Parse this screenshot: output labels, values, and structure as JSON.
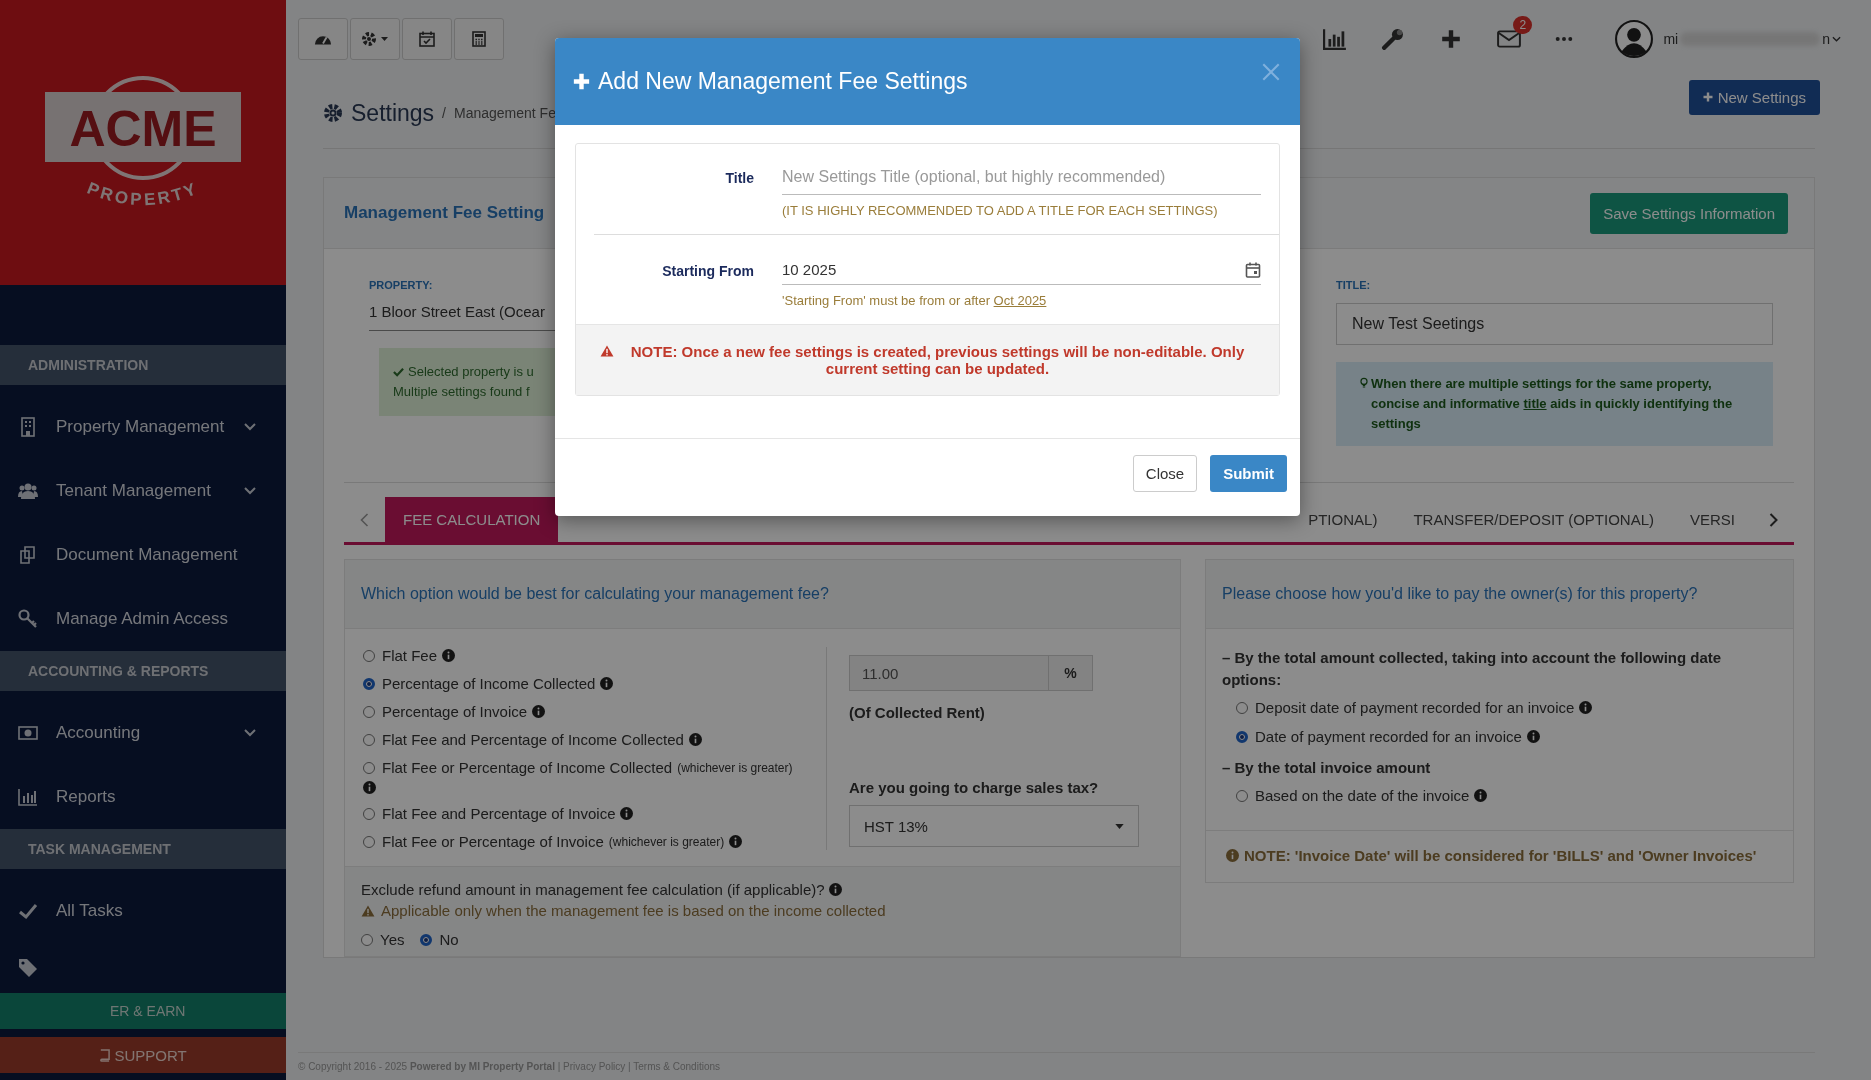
{
  "topbar": {
    "mail_badge": "2",
    "user_name_start": "mi",
    "user_name_end": "n"
  },
  "sidebar": {
    "logo": {
      "name": "ACME",
      "sub": "PROPERTY"
    },
    "sections": [
      {
        "heading": "ADMINISTRATION",
        "items": [
          {
            "label": "Property Management",
            "expandable": true
          },
          {
            "label": "Tenant Management",
            "expandable": true
          },
          {
            "label": "Document Management",
            "expandable": false
          },
          {
            "label": "Manage Admin Access",
            "expandable": false
          }
        ]
      },
      {
        "heading": "ACCOUNTING & REPORTS",
        "items": [
          {
            "label": "Accounting",
            "expandable": true
          },
          {
            "label": "Reports",
            "expandable": false
          }
        ]
      },
      {
        "heading": "TASK MANAGEMENT",
        "items": [
          {
            "label": "All Tasks",
            "expandable": false
          }
        ]
      }
    ],
    "refer_button": "ER & EARN",
    "support_button": "SUPPORT"
  },
  "breadcrumb": {
    "title": "Settings",
    "separator": "/",
    "current": "Management Fe"
  },
  "new_settings_button": "New Settings",
  "card": {
    "title": "Management Fee Setting",
    "save_button": "Save Settings Information",
    "property": {
      "label": "PROPERTY:",
      "value": "1 Bloor Street East (Ocear"
    },
    "alert_lines": [
      "Selected property is u",
      "Multiple settings found f"
    ],
    "title_field": {
      "label": "TITLE:",
      "value": "New Test Seetings"
    },
    "tip": {
      "before": "When there are multiple settings for the same property, concise and informative ",
      "link": "title",
      "after": " aids in quickly identifying the settings"
    }
  },
  "tabs": [
    {
      "label": "FEE CALCULATION",
      "selected": true
    },
    {
      "label": "PTIONAL)",
      "selected": false
    },
    {
      "label": "TRANSFER/DEPOSIT (OPTIONAL)",
      "selected": false
    },
    {
      "label": "VERSI",
      "selected": false
    }
  ],
  "fee_panel": {
    "question": "Which option would be best for calculating your management fee?",
    "options": [
      {
        "label": "Flat Fee",
        "selected": false
      },
      {
        "label": "Percentage of Income Collected",
        "selected": true
      },
      {
        "label": "Percentage of Invoice",
        "selected": false
      },
      {
        "label": "Flat Fee and Percentage of Income Collected",
        "selected": false
      },
      {
        "label": "Flat Fee or Percentage of Income Collected",
        "note": "(whichever is greater)",
        "selected": false
      },
      {
        "label": "Flat Fee and Percentage of Invoice",
        "selected": false
      },
      {
        "label": "Flat Fee or Percentage of Invoice",
        "note": "(whichever is greater)",
        "selected": false
      }
    ],
    "rate": {
      "value": "11.00",
      "unit": "%",
      "caption": "(Of Collected Rent)"
    },
    "tax": {
      "question": "Are you going to charge sales tax?",
      "value": "HST 13%"
    },
    "refund": {
      "question": "Exclude refund amount in management fee calculation (if applicable)?",
      "warning": "Applicable only when the management fee is based on the income collected",
      "options": [
        {
          "label": "Yes",
          "selected": false
        },
        {
          "label": "No",
          "selected": true
        }
      ]
    }
  },
  "owner_panel": {
    "question": "Please choose how you'd like to pay the owner(s) for this property?",
    "groups": [
      {
        "heading": "– By the total amount collected, taking into account the following date options:",
        "options": [
          {
            "label": "Deposit date of payment recorded for an invoice",
            "selected": false
          },
          {
            "label": "Date of payment recorded for an invoice",
            "selected": true
          }
        ]
      },
      {
        "heading": "– By the total invoice amount",
        "options": [
          {
            "label": "Based on the date of the invoice",
            "selected": false
          }
        ]
      }
    ],
    "note": "NOTE: 'Invoice Date' will be considered for 'BILLS' and 'Owner Invoices'"
  },
  "footer": "© Copyright 2016 - 2025 **Powered by MI Property Portal** | Privacy Policy | Terms & Conditions",
  "modal": {
    "title": "Add New Management Fee Settings",
    "title_label": "Title",
    "title_placeholder": "New Settings Title (optional, but highly recommended)",
    "title_hint": "(IT IS HIGHLY RECOMMENDED TO ADD A TITLE FOR EACH SETTINGS)",
    "start_label": "Starting From",
    "start_value": "10 2025",
    "start_hint": "'Starting From' must be from or after",
    "start_hint_link": "Oct 2025",
    "note": "NOTE: Once a new fee settings is created, previous settings will be non-editable. Only current setting can be updated.",
    "close_button": "Close",
    "submit_button": "Submit"
  }
}
